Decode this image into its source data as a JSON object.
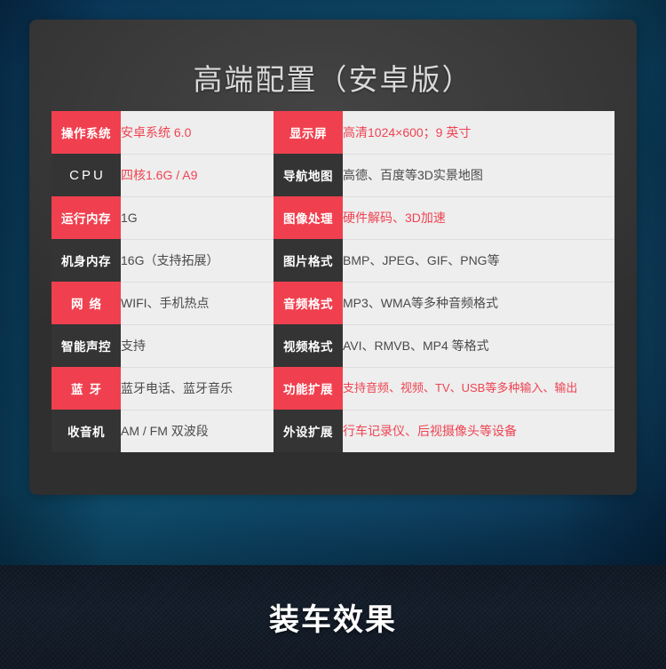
{
  "card": {
    "title": "高端配置（安卓版）"
  },
  "colors": {
    "accent_red": "#F0404F",
    "label_dark": "#343434",
    "value_bg": "#EEEEEE",
    "value_text": "#4A4A4A",
    "value_text_red": "#EF4352",
    "card_bg": "#3B3B3B",
    "page_blue": "#0E5070",
    "bottom_band": "#151F2C"
  },
  "spec_table": {
    "rows": [
      {
        "left_label": "操作系统",
        "left_label_style": "red",
        "left_value": "安卓系统 6.0",
        "left_value_red": true,
        "right_label": "显示屏",
        "right_label_style": "red",
        "right_value": "高清1024×600；9 英寸",
        "right_value_red": true
      },
      {
        "left_label": "CPU",
        "left_label_style": "dark",
        "left_value": "四核1.6G / A9",
        "left_value_red": true,
        "right_label": "导航地图",
        "right_label_style": "dark",
        "right_value": "高德、百度等3D实景地图",
        "right_value_red": false
      },
      {
        "left_label": "运行内存",
        "left_label_style": "red",
        "left_value": "1G",
        "left_value_red": false,
        "right_label": "图像处理",
        "right_label_style": "red",
        "right_value": "硬件解码、3D加速",
        "right_value_red": true
      },
      {
        "left_label": "机身内存",
        "left_label_style": "dark",
        "left_value": "16G（支持拓展）",
        "left_value_red": false,
        "right_label": "图片格式",
        "right_label_style": "dark",
        "right_value": "BMP、JPEG、GIF、PNG等",
        "right_value_red": false
      },
      {
        "left_label": "网 络",
        "left_label_style": "red",
        "left_value": "WIFI、手机热点",
        "left_value_red": false,
        "right_label": "音频格式",
        "right_label_style": "red",
        "right_value": "MP3、WMA等多种音频格式",
        "right_value_red": false
      },
      {
        "left_label": "智能声控",
        "left_label_style": "dark",
        "left_value": "支持",
        "left_value_red": false,
        "right_label": "视频格式",
        "right_label_style": "dark",
        "right_value": "AVI、RMVB、MP4 等格式",
        "right_value_red": false
      },
      {
        "left_label": "蓝 牙",
        "left_label_style": "red",
        "left_value": "蓝牙电话、蓝牙音乐",
        "left_value_red": false,
        "right_label": "功能扩展",
        "right_label_style": "red",
        "right_value": "支持音频、视频、TV、USB等多种输入、输出",
        "right_value_red": true
      },
      {
        "left_label": "收音机",
        "left_label_style": "dark",
        "left_value": "AM / FM 双波段",
        "left_value_red": false,
        "right_label": "外设扩展",
        "right_label_style": "dark",
        "right_value": "行车记录仪、后视摄像头等设备",
        "right_value_red": true
      }
    ]
  },
  "bottom_section": {
    "title": "装车效果"
  }
}
